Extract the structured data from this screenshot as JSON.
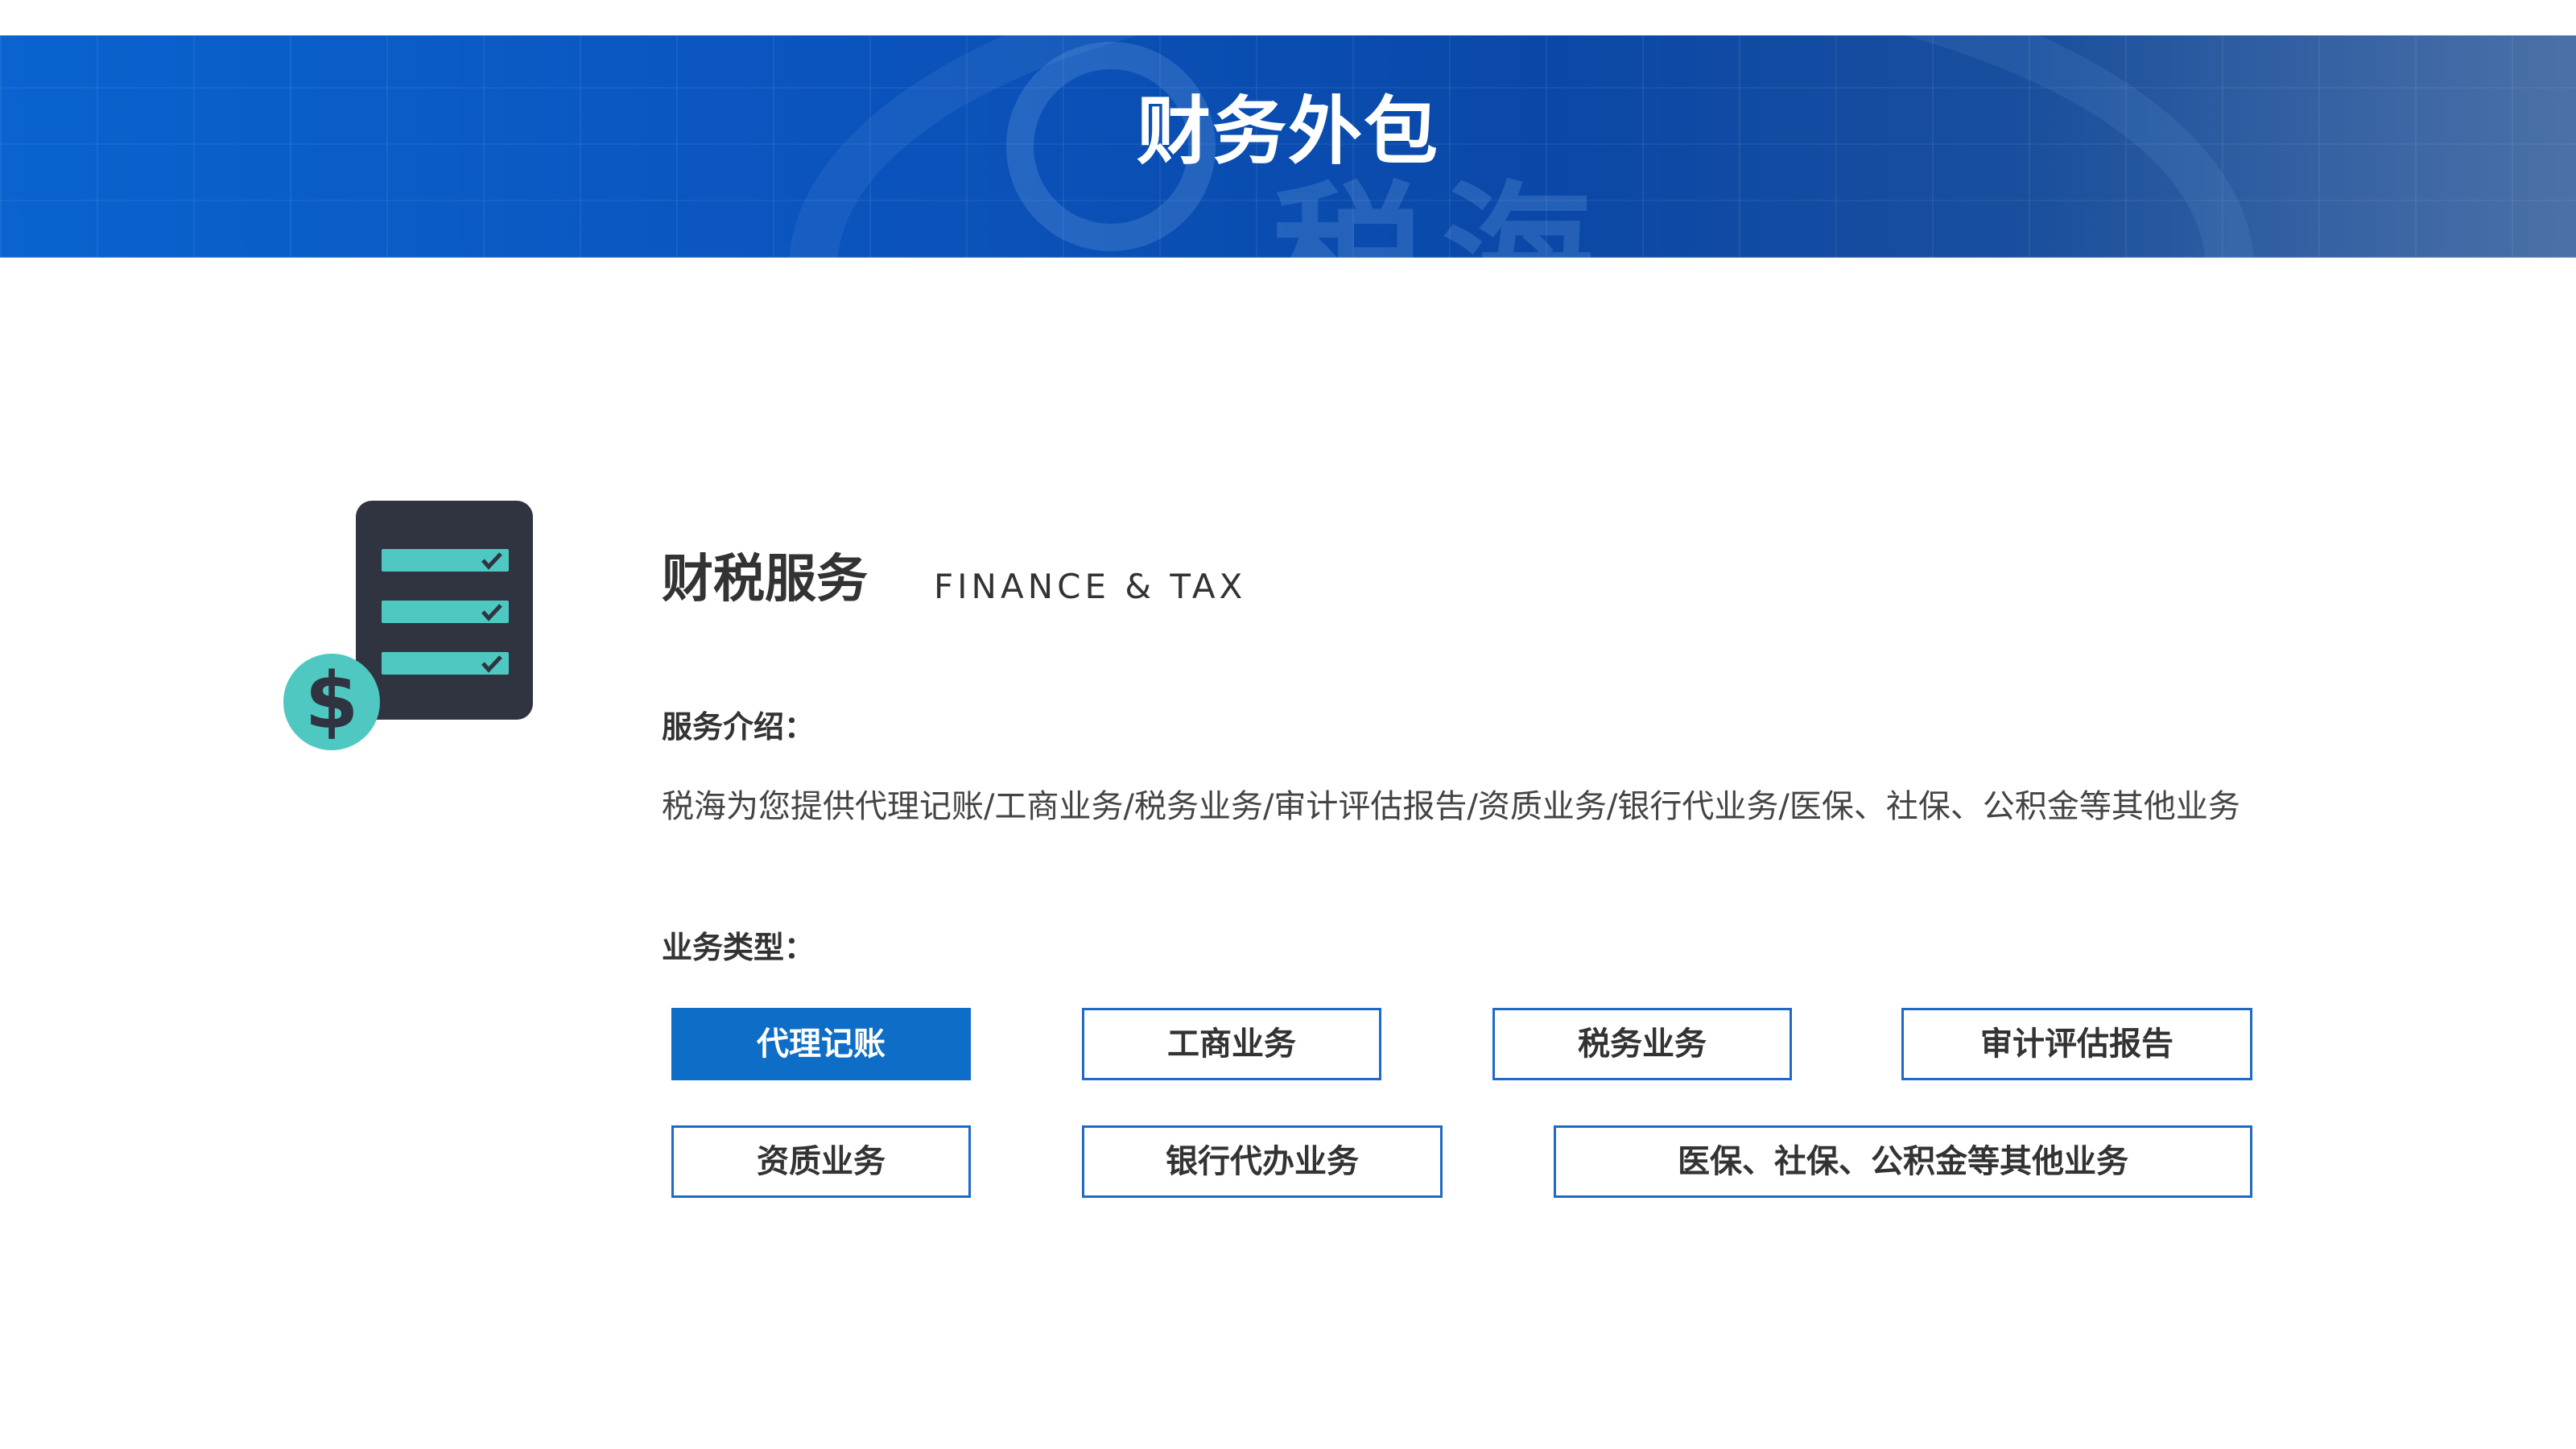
{
  "banner": {
    "title": "财务外包",
    "watermark_text": "税海"
  },
  "section": {
    "title": "财税服务",
    "subtitle": "FINANCE & TAX",
    "icon": "checklist-document-dollar-icon"
  },
  "intro": {
    "label": "服务介绍：",
    "text": "税海为您提供代理记账/工商业务/税务业务/审计评估报告/资质业务/银行代业务/医保、社保、公积金等其他业务"
  },
  "types": {
    "label": "业务类型：",
    "items": [
      {
        "label": "代理记账",
        "active": true
      },
      {
        "label": "工商业务",
        "active": false
      },
      {
        "label": "税务业务",
        "active": false
      },
      {
        "label": "审计评估报告",
        "active": false
      },
      {
        "label": "资质业务",
        "active": false
      },
      {
        "label": "银行代办业务",
        "active": false
      },
      {
        "label": "医保、社保、公积金等其他业务",
        "active": false
      }
    ]
  },
  "colors": {
    "accent": "#0e6dc6",
    "button_border": "#1f6ac7",
    "icon_dark": "#2f3440",
    "icon_teal": "#4ec8c0"
  }
}
